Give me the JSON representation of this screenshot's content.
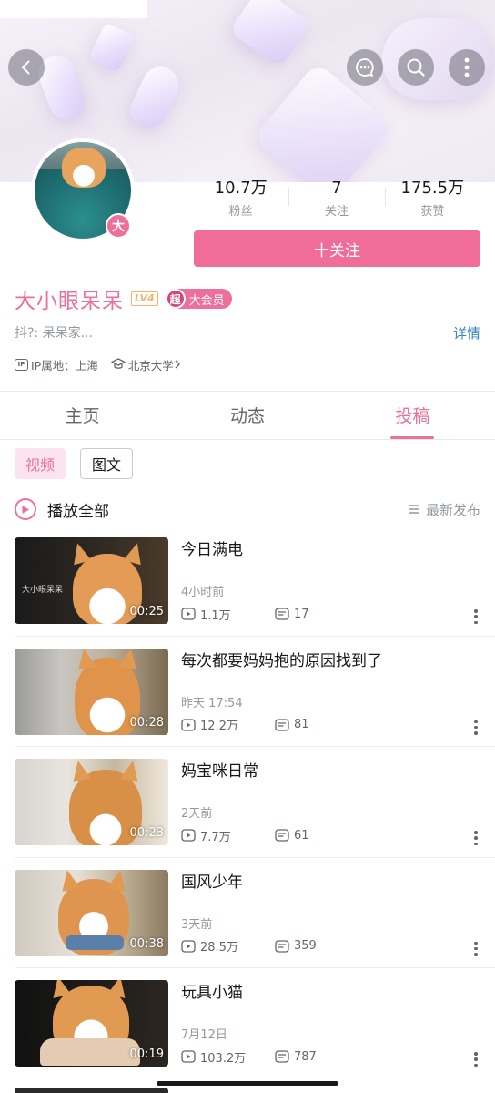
{
  "profile": {
    "avatar_badge": "大",
    "name": "大小眼呆呆",
    "level": "LV4",
    "member_super": "超",
    "member_label": "大会员",
    "bio": "抖?: 呆呆家...",
    "detail_link": "详情",
    "ip_icon_text": "IP",
    "ip_location": "IP属地：上海",
    "school": "北京大学"
  },
  "stats": [
    {
      "value": "10.7万",
      "label": "粉丝"
    },
    {
      "value": "7",
      "label": "关注"
    },
    {
      "value": "175.5万",
      "label": "获赞"
    }
  ],
  "follow_button": "十关注",
  "tabs": [
    "主页",
    "动态",
    "投稿"
  ],
  "active_tab": "投稿",
  "sub_tabs": [
    "视频",
    "图文"
  ],
  "play_all": "播放全部",
  "sort_label": "最新发布",
  "videos": [
    {
      "title": "今日满电",
      "time": "4小时前",
      "views": "1.1万",
      "comments": "17",
      "duration": "00:25",
      "watermark": "大小眼呆呆"
    },
    {
      "title": "每次都要妈妈抱的原因找到了",
      "time": "昨天 17:54",
      "views": "12.2万",
      "comments": "81",
      "duration": "00:28"
    },
    {
      "title": "妈宝咪日常",
      "time": "2天前",
      "views": "7.7万",
      "comments": "61",
      "duration": "00:23"
    },
    {
      "title": "国风少年",
      "time": "3天前",
      "views": "28.5万",
      "comments": "359",
      "duration": "00:38"
    },
    {
      "title": "玩具小猫",
      "time": "7月12日",
      "views": "103.2万",
      "comments": "787",
      "duration": "00:19"
    }
  ],
  "colors": {
    "accent": "#ee6f9b",
    "follow_button": "#f06d99",
    "link": "#3a82c4",
    "level_badge": "#f7b36a"
  }
}
